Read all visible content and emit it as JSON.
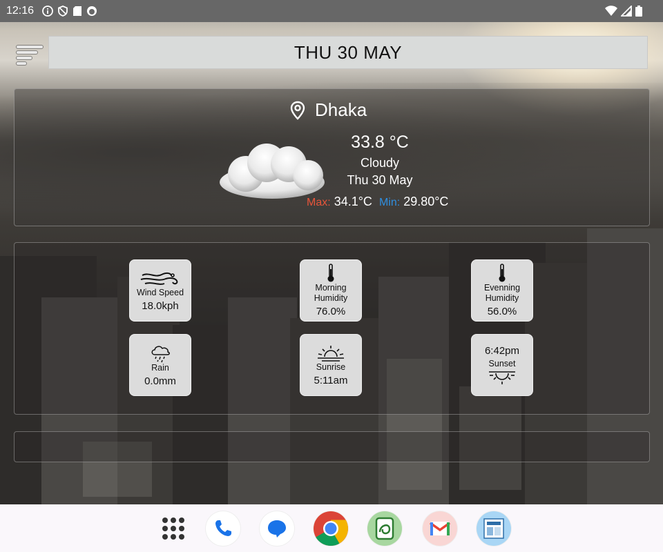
{
  "status_bar": {
    "time": "12:16",
    "left_icons": [
      "info-icon",
      "shield-icon",
      "sd-card-icon",
      "app-notification-icon"
    ],
    "right_icons": [
      "wifi-icon",
      "signal-icon",
      "battery-icon"
    ]
  },
  "header": {
    "menu_icon": "sort-menu-icon",
    "date_title": "THU 30 MAY"
  },
  "weather": {
    "location": "Dhaka",
    "temperature": "33.8 °C",
    "condition": "Cloudy",
    "date": "Thu 30 May",
    "max_label": "Max:",
    "max_value": "34.1°C",
    "min_label": "Min:",
    "min_value": "29.80°C",
    "colors": {
      "max_label": "#e8553a",
      "min_label": "#2f8fe0"
    }
  },
  "tiles": {
    "wind": {
      "icon": "wind-icon",
      "label": "Wind Speed",
      "value": "18.0kph"
    },
    "morning_humidity": {
      "icon": "thermometer-icon",
      "label_line1": "Morning",
      "label_line2": "Humidity",
      "value": "76.0%"
    },
    "evening_humidity": {
      "icon": "thermometer-icon",
      "label_line1": "Evenning",
      "label_line2": "Humidity",
      "value": "56.0%"
    },
    "rain": {
      "icon": "rain-cloud-icon",
      "label": "Rain",
      "value": "0.0mm"
    },
    "sunrise": {
      "icon": "sunrise-icon",
      "label": "Sunrise",
      "value": "5:11am"
    },
    "sunset": {
      "icon": "sunset-icon",
      "label": "Sunset",
      "value": "6:42pm"
    }
  },
  "dock": {
    "apps": [
      "app-drawer-icon",
      "phone-icon",
      "messages-icon",
      "chrome-icon",
      "green-app-icon",
      "gmail-icon",
      "app-shortcut-icon"
    ]
  }
}
